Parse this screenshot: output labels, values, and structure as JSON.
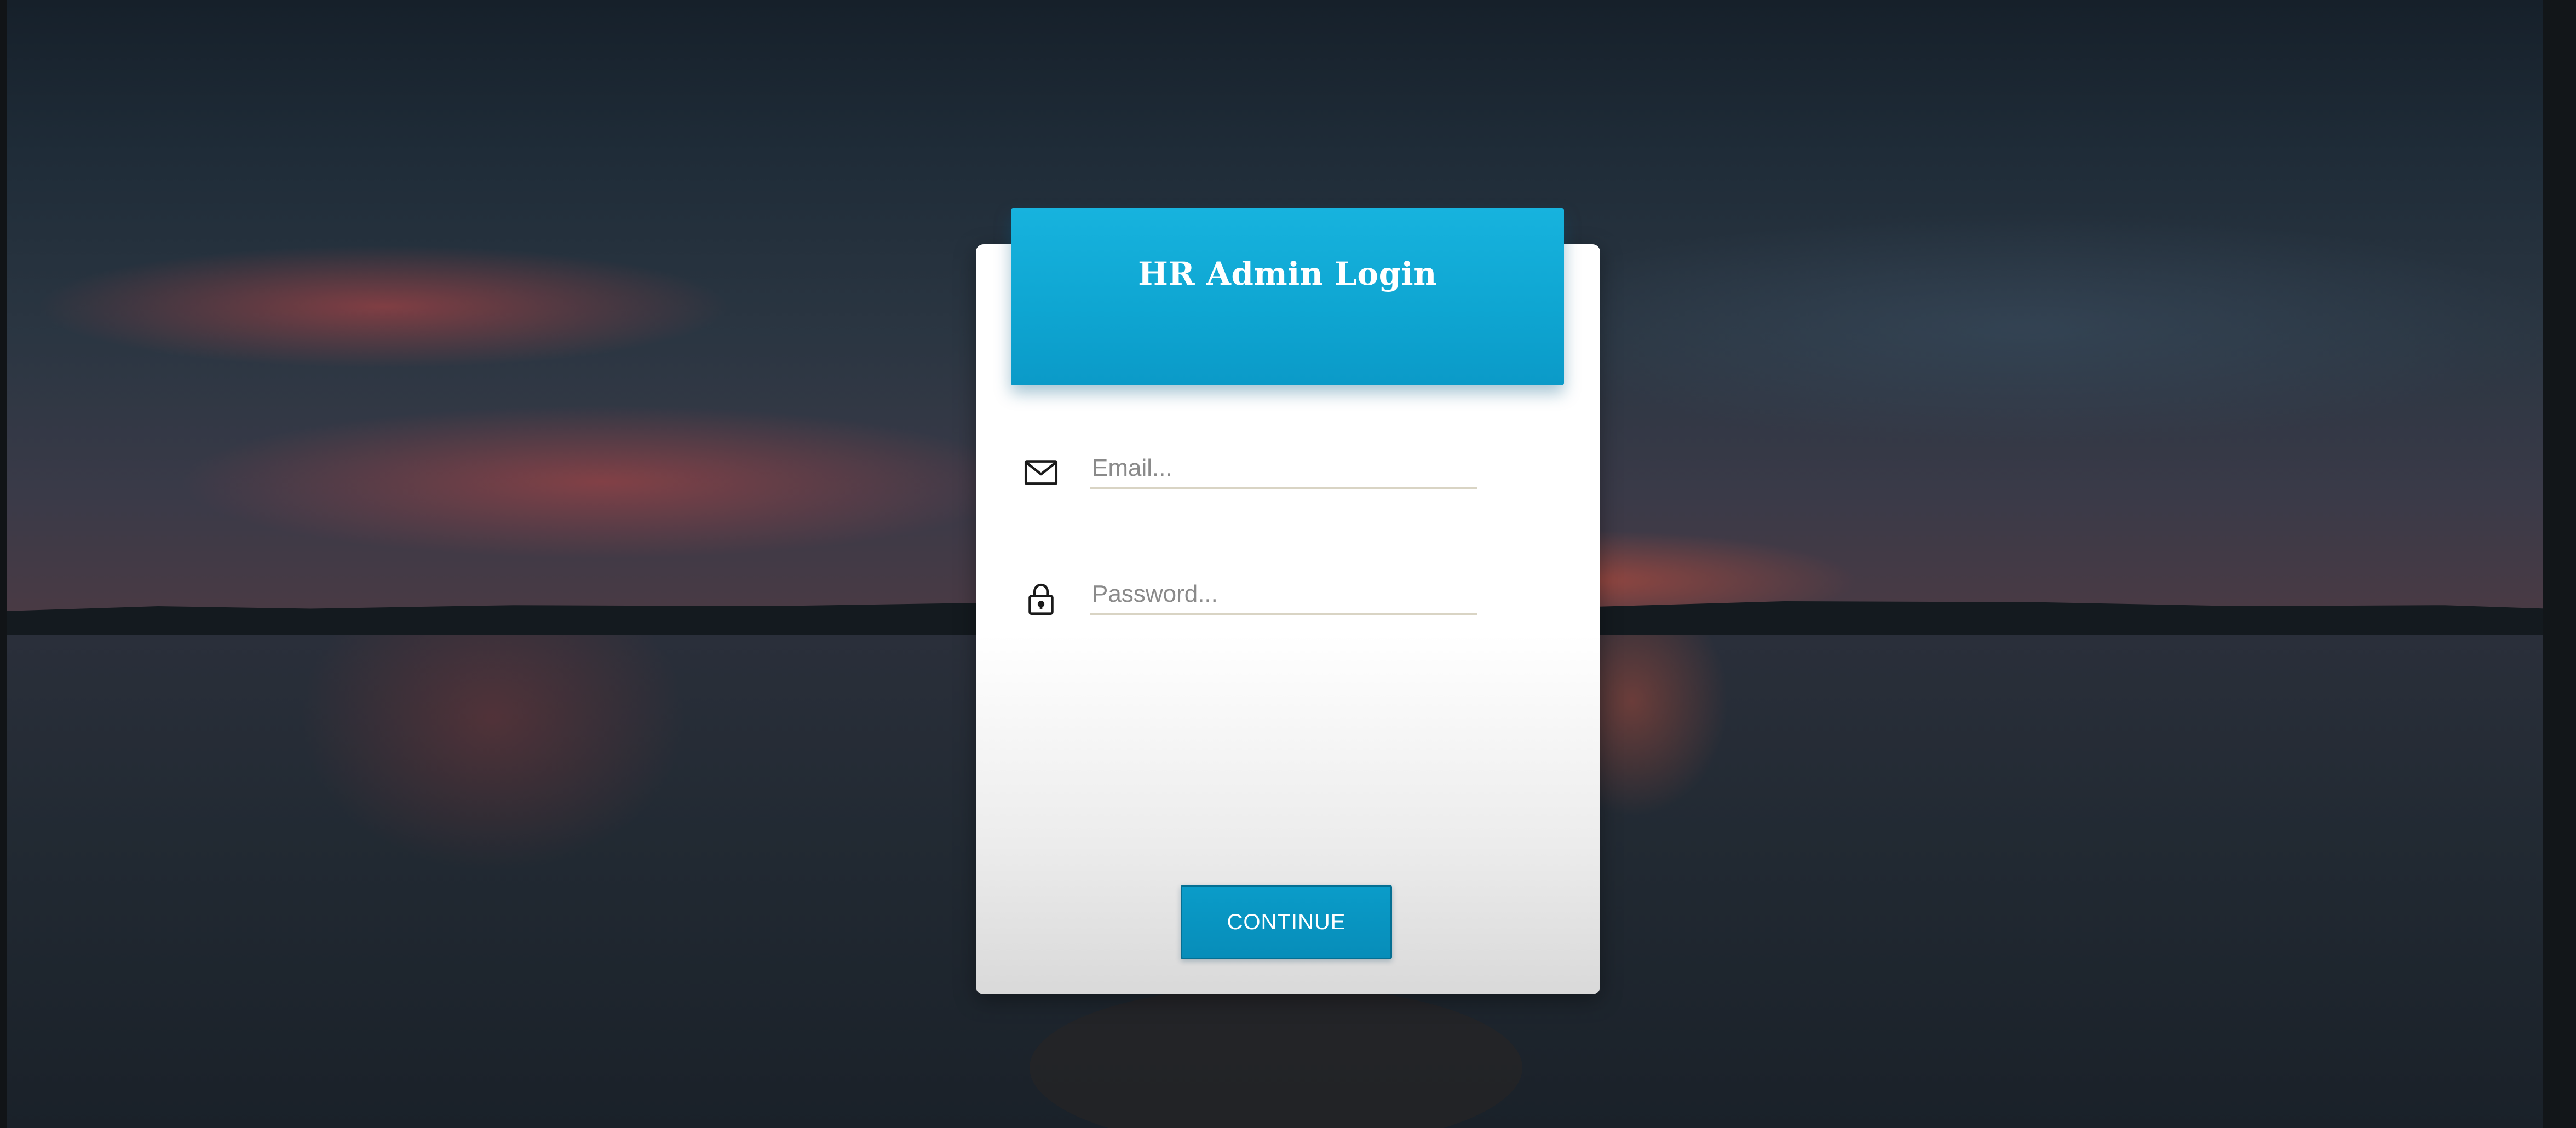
{
  "login": {
    "title": "HR Admin Login",
    "email_placeholder": "Email...",
    "password_placeholder": "Password...",
    "continue_label": "CONTINUE"
  },
  "icons": {
    "email": "envelope-icon",
    "password": "lock-icon"
  },
  "colors": {
    "accent": "#0ea5d1",
    "button": "#078db9"
  }
}
